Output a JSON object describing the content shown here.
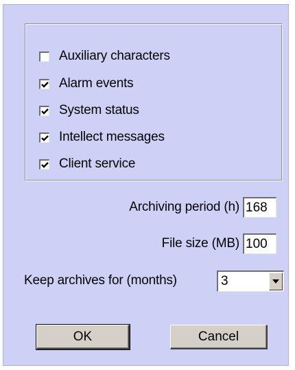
{
  "options": [
    {
      "label": "Auxiliary characters",
      "checked": false
    },
    {
      "label": "Alarm events",
      "checked": true
    },
    {
      "label": "System status",
      "checked": true
    },
    {
      "label": "Intellect messages",
      "checked": true
    },
    {
      "label": "Client service",
      "checked": true
    }
  ],
  "archiving_period": {
    "label": "Archiving period (h)",
    "value": "168"
  },
  "file_size": {
    "label": "File size (MB)",
    "value": "100"
  },
  "keep_archives": {
    "label": "Keep archives for (months)",
    "value": "3"
  },
  "buttons": {
    "ok": "OK",
    "cancel": "Cancel"
  },
  "colors": {
    "dialog_bg": "#cdd1f5",
    "button_face": "#d4d0c8"
  }
}
